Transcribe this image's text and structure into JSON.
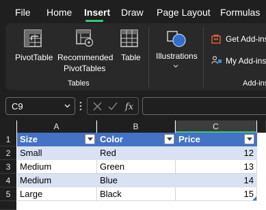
{
  "menu": {
    "tabs": [
      {
        "label": "File"
      },
      {
        "label": "Home"
      },
      {
        "label": "Insert",
        "active": true
      },
      {
        "label": "Draw"
      },
      {
        "label": "Page Layout"
      },
      {
        "label": "Formulas"
      }
    ]
  },
  "ribbon": {
    "pivot_table_label": "PivotTable",
    "recommended_line1": "Recommended",
    "recommended_line2": "PivotTables",
    "table_label": "Table",
    "tables_group_label": "Tables",
    "illustrations_label": "Illustrations",
    "get_addins_label": "Get Add-ins",
    "my_addins_label": "My Add-ins",
    "addins_group_label": "Add-ins"
  },
  "formula_bar": {
    "name_box_value": "C9",
    "formula_value": ""
  },
  "grid": {
    "columns": [
      "A",
      "B",
      "C"
    ],
    "selected_column": "C",
    "rows": [
      "1",
      "2",
      "3",
      "4",
      "5"
    ],
    "table": {
      "headers": [
        "Size",
        "Color",
        "Price"
      ],
      "rows": [
        [
          "Small",
          "Red",
          "12"
        ],
        [
          "Medium",
          "Green",
          "13"
        ],
        [
          "Medium",
          "Blue",
          "14"
        ],
        [
          "Large",
          "Black",
          "15"
        ]
      ]
    }
  },
  "colors": {
    "accent": "#3cc47c",
    "table_header": "#4472c4",
    "table_band": "#d9e1f2"
  }
}
